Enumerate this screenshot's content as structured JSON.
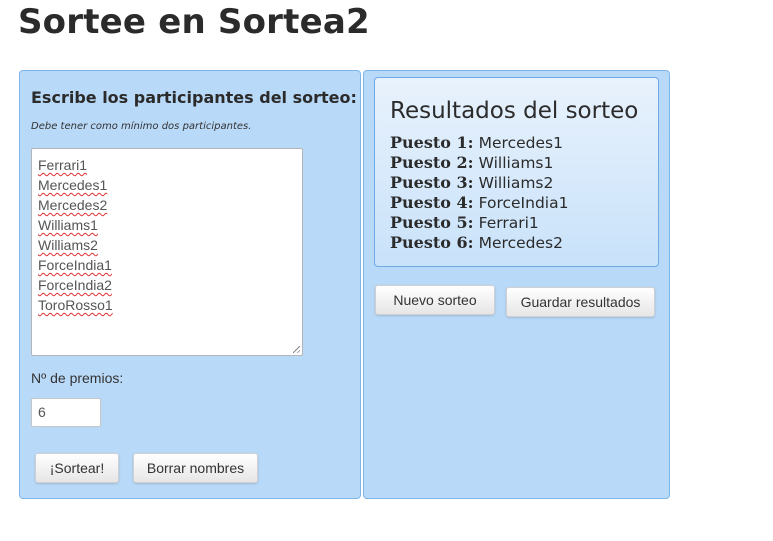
{
  "page": {
    "title": "Sortee en Sortea2"
  },
  "form": {
    "heading": "Escribe los participantes del sorteo:",
    "hint": "Debe tener como mínimo dos participantes.",
    "participants": [
      "Ferrari1",
      "Mercedes1",
      "Mercedes2",
      "Williams1",
      "Williams2",
      "ForceIndia1",
      "ForceIndia2",
      "ToroRosso1"
    ],
    "prizes_label": "Nº de premios:",
    "prizes_value": "6",
    "draw_button": "¡Sortear!",
    "clear_button": "Borrar nombres"
  },
  "results": {
    "title": "Resultados del sorteo",
    "items": [
      {
        "position": "Puesto 1:",
        "name": "Mercedes1"
      },
      {
        "position": "Puesto 2:",
        "name": "Williams1"
      },
      {
        "position": "Puesto 3:",
        "name": "Williams2"
      },
      {
        "position": "Puesto 4:",
        "name": "ForceIndia1"
      },
      {
        "position": "Puesto 5:",
        "name": "Ferrari1"
      },
      {
        "position": "Puesto 6:",
        "name": "Mercedes2"
      }
    ],
    "new_draw_button": "Nuevo sorteo",
    "save_button": "Guardar resultados"
  },
  "colors": {
    "panel_bg": "#b9d9f8",
    "panel_border": "#7eb6ea",
    "spellcheck_underline": "#e03030"
  }
}
